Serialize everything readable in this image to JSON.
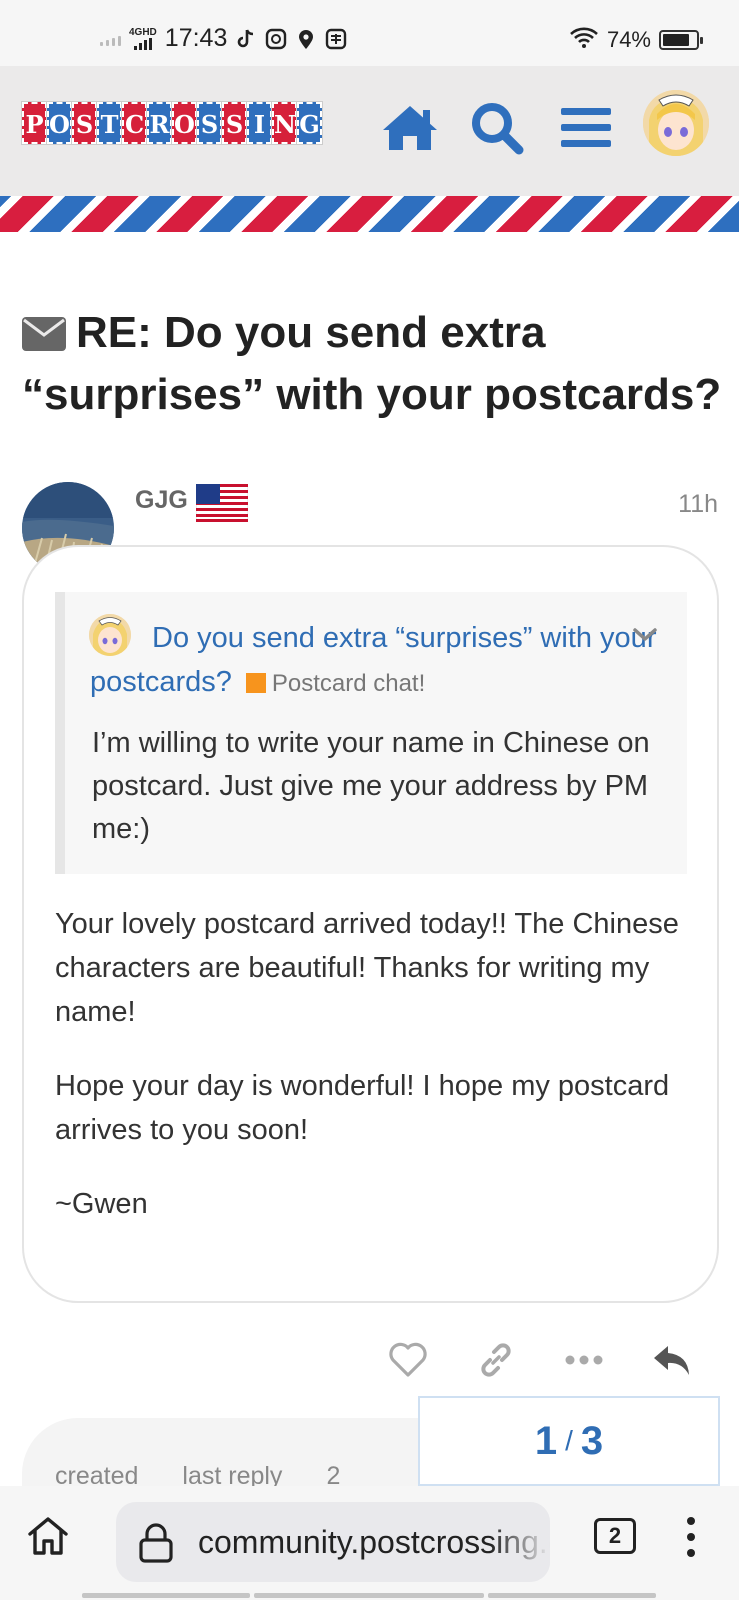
{
  "status_bar": {
    "network": "4GHD",
    "time": "17:43",
    "battery": "74%"
  },
  "header": {
    "logo_letters": [
      "P",
      "O",
      "S",
      "T",
      "C",
      "R",
      "O",
      "S",
      "S",
      "I",
      "N",
      "G"
    ],
    "brand_blue": "#2f6fbd",
    "brand_red": "#d6203a"
  },
  "topic": {
    "title": "RE: Do you send extra “surprises” with your postcards?"
  },
  "post": {
    "username": "GJG",
    "time": "11h",
    "quote": {
      "title": "Do you send extra “surprises” with your postcards?",
      "category": "Postcard chat!",
      "category_color": "#f7941d",
      "body": "I’m willing to write your name in Chinese on postcard. Just give me your address by PM me:)"
    },
    "paragraphs": [
      "Your lovely postcard arrived today!! The Chinese characters are beautiful! Thanks for writing my name!",
      "Hope your day is wonderful! I hope my postcard arrives to you soon!",
      "~Gwen"
    ]
  },
  "actions": [
    "heart-icon",
    "link-icon",
    "more-icon",
    "reply-icon"
  ],
  "next_meta": {
    "created": "created",
    "last_reply": "last reply",
    "count": "2"
  },
  "progress": {
    "current": "1",
    "separator": "/",
    "total": "3"
  },
  "browser": {
    "url": "community.postcrossing.com",
    "tab_count": "2"
  }
}
